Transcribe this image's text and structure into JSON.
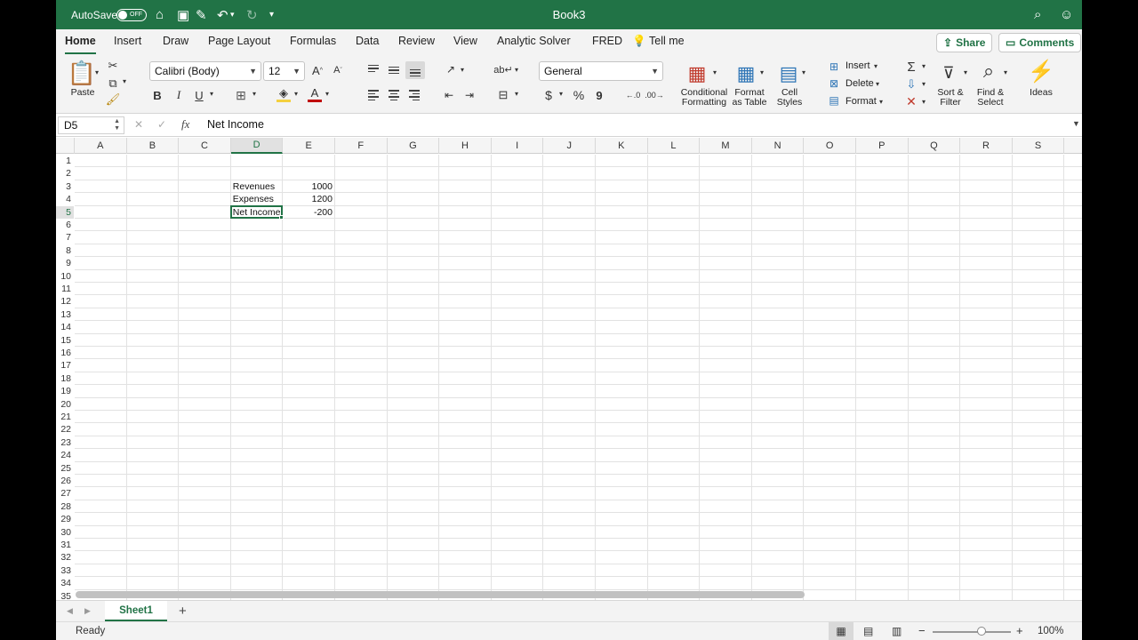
{
  "titlebar": {
    "autosave_label": "AutoSave",
    "autosave_state": "OFF",
    "document_title": "Book3"
  },
  "ribbon": {
    "tabs": [
      "Home",
      "Insert",
      "Draw",
      "Page Layout",
      "Formulas",
      "Data",
      "Review",
      "View",
      "Analytic Solver",
      "FRED"
    ],
    "tell_me": "Tell me",
    "share_label": "Share",
    "comments_label": "Comments",
    "paste_label": "Paste",
    "font_name": "Calibri (Body)",
    "font_size": "12",
    "bold": "B",
    "italic": "I",
    "underline": "U",
    "number_format": "General",
    "currency_symbol": "$",
    "percent_symbol": "%",
    "comma_symbol": "9",
    "conditional_formatting": [
      "Conditional",
      "Formatting"
    ],
    "format_as_table": [
      "Format",
      "as Table"
    ],
    "cell_styles": [
      "Cell",
      "Styles"
    ],
    "insert_label": "Insert",
    "delete_label": "Delete",
    "format_label": "Format",
    "sort_filter": [
      "Sort &",
      "Filter"
    ],
    "find_select": [
      "Find &",
      "Select"
    ],
    "ideas_label": "Ideas"
  },
  "formula_bar": {
    "name_box": "D5",
    "fx_label": "fx",
    "content": "Net Income"
  },
  "sheet": {
    "columns": [
      "A",
      "B",
      "C",
      "D",
      "E",
      "F",
      "G",
      "H",
      "I",
      "J",
      "K",
      "L",
      "M",
      "N",
      "O",
      "P",
      "Q",
      "R",
      "S"
    ],
    "rows": [
      "1",
      "2",
      "3",
      "4",
      "5",
      "6",
      "7",
      "8",
      "9",
      "10",
      "11",
      "12",
      "13",
      "14",
      "15",
      "16",
      "17",
      "18",
      "19",
      "20",
      "21",
      "22",
      "23",
      "24",
      "25",
      "26",
      "27",
      "28",
      "29",
      "30",
      "31",
      "32",
      "33",
      "34",
      "35"
    ],
    "cells": {
      "D3": "Revenues",
      "E3": "1000",
      "D4": "Expenses",
      "E4": "1200",
      "D5": "Net Income",
      "E5": "-200"
    },
    "selected_cell": "D5"
  },
  "sheet_tabs": {
    "active": "Sheet1",
    "add": "+"
  },
  "status": {
    "ready": "Ready",
    "zoom": "100%",
    "zoom_level": 1.0
  },
  "colors": {
    "accent": "#217346"
  }
}
